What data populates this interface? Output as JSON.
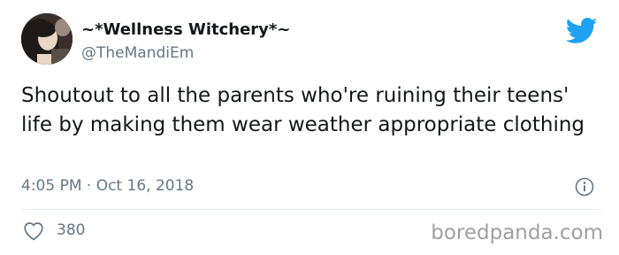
{
  "tweet": {
    "author": {
      "display_name": "~*Wellness Witchery*~",
      "handle": "@TheMandiEm",
      "avatar": "avatar"
    },
    "text": "Shoutout to all the parents who're ruining their teens' life by making them wear weather appropriate clothing",
    "timestamp": "4:05 PM · Oct 16, 2018",
    "likes": "380"
  },
  "icons": {
    "brand": "twitter-bird-icon",
    "info": "info-icon",
    "like": "heart-icon"
  },
  "colors": {
    "twitter_blue": "#1da1f2",
    "secondary_text": "#657786",
    "primary_text": "#14171a",
    "divider": "#e1e8ed"
  },
  "watermark": "boredpanda.com"
}
